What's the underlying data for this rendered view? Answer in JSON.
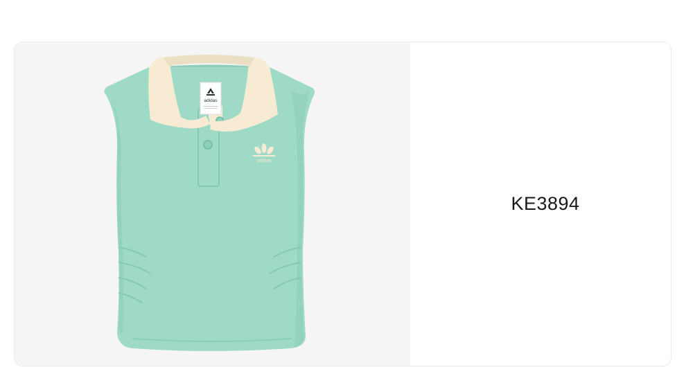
{
  "product": {
    "article_code": "KE3894",
    "image": {
      "label_brand": "adidas",
      "chest_logo_text": "adidas",
      "colors": {
        "body": "#9fdac7",
        "body_shade": "#8ccdb8",
        "collar": "#f7ecd3",
        "collar_shade": "#eadfc2",
        "buttons": "#8cd0bb",
        "background": "#f5f5f5"
      }
    }
  }
}
